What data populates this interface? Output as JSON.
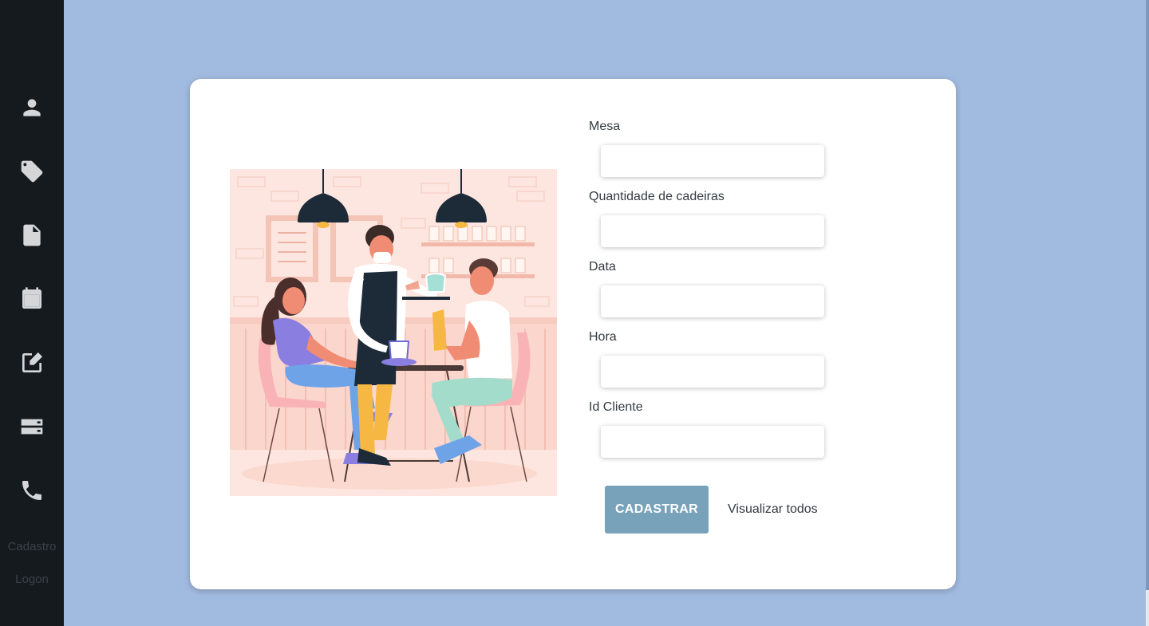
{
  "sidebar": {
    "icons": [
      {
        "name": "user-icon"
      },
      {
        "name": "tag-icon"
      },
      {
        "name": "document-icon"
      },
      {
        "name": "calendar-icon"
      },
      {
        "name": "edit-icon"
      },
      {
        "name": "storage-icon"
      },
      {
        "name": "phone-icon"
      }
    ],
    "links": {
      "register": "Cadastro",
      "logon": "Logon"
    }
  },
  "form": {
    "fields": [
      {
        "label": "Mesa",
        "value": "",
        "placeholder": ""
      },
      {
        "label": "Quantidade de cadeiras",
        "value": "",
        "placeholder": ""
      },
      {
        "label": "Data",
        "value": "",
        "placeholder": ""
      },
      {
        "label": "Hora",
        "value": "",
        "placeholder": ""
      },
      {
        "label": "Id Cliente",
        "value": "",
        "placeholder": ""
      }
    ],
    "submit_label": "CADASTRAR",
    "view_all_label": "Visualizar todos"
  },
  "colors": {
    "background": "#a1badf",
    "sidebar": "#151a1e",
    "button": "#77a2ba"
  }
}
